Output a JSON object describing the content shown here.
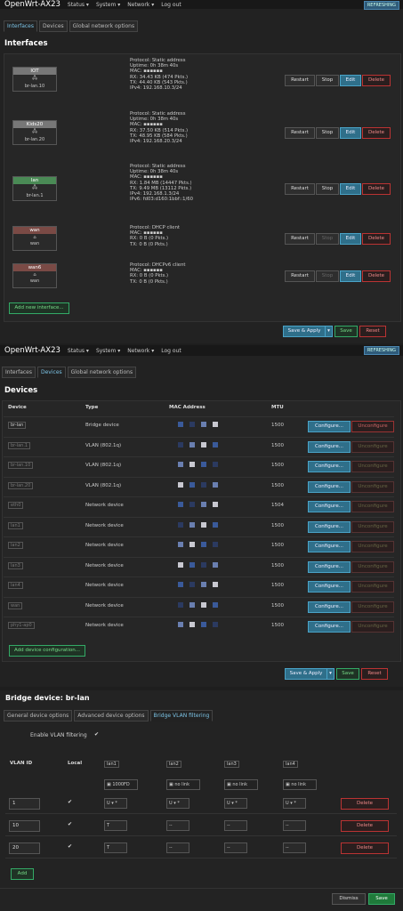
{
  "panel1": {
    "brand": "OpenWrt-AX23",
    "menu": [
      "Status ▾",
      "System ▾",
      "Network ▾",
      "Log out"
    ],
    "badge": "REFRESHING",
    "tabs": [
      "Interfaces",
      "Devices",
      "Global network options"
    ],
    "heading": "Interfaces",
    "interfaces": [
      {
        "name": "IOT",
        "device": "br-lan.10",
        "color": "#777777",
        "lines": [
          "Protocol: Static address",
          "Uptime: 0h 38m 40s",
          "MAC: ▪▪▪▪▪▪",
          "RX: 34.43 KB (474 Pkts.)",
          "TX: 44.40 KB (543 Pkts.)",
          "IPv4: 192.168.10.3/24"
        ]
      },
      {
        "name": "Kids20",
        "device": "br-lan.20",
        "color": "#777777",
        "lines": [
          "Protocol: Static address",
          "Uptime: 0h 38m 40s",
          "MAC: ▪▪▪▪▪▪",
          "RX: 37.50 KB (514 Pkts.)",
          "TX: 48.95 KB (584 Pkts.)",
          "IPv4: 192.168.20.3/24"
        ]
      },
      {
        "name": "lan",
        "device": "br-lan.1",
        "color": "#4a8a55",
        "lines": [
          "Protocol: Static address",
          "Uptime: 0h 38m 40s",
          "MAC: ▪▪▪▪▪▪",
          "RX: 1.84 MB (14447 Pkts.)",
          "TX: 9.49 MB (13112 Pkts.)",
          "IPv4: 192.168.1.3/24",
          "IPv6: fd03:d160:1bbf::1/60"
        ]
      },
      {
        "name": "wan",
        "device": "wan",
        "color": "#7a4a45",
        "lines": [
          "Protocol: DHCP client",
          "MAC: ▪▪▪▪▪▪",
          "RX: 0 B (0 Pkts.)",
          "TX: 0 B (0 Pkts.)"
        ]
      },
      {
        "name": "wan6",
        "device": "wan",
        "color": "#7a4a45",
        "lines": [
          "Protocol: DHCPv6 client",
          "MAC: ▪▪▪▪▪▪",
          "RX: 0 B (0 Pkts.)",
          "TX: 0 B (0 Pkts.)"
        ]
      }
    ],
    "buttons": {
      "restart": "Restart",
      "stop": "Stop",
      "edit": "Edit",
      "delete": "Delete"
    },
    "add_interface": "Add new interface...",
    "save_apply": "Save & Apply",
    "save": "Save",
    "reset": "Reset"
  },
  "panel2": {
    "brand": "OpenWrt-AX23",
    "menu": [
      "Status ▾",
      "System ▾",
      "Network ▾",
      "Log out"
    ],
    "badge": "REFRESHING",
    "tabs": [
      "Interfaces",
      "Devices",
      "Global network options"
    ],
    "heading": "Devices",
    "columns": [
      "Device",
      "Type",
      "MAC Address",
      "MTU"
    ],
    "devices": [
      {
        "name": "br-lan",
        "type": "Bridge device",
        "mtu": "1500",
        "unconfigure_enabled": true
      },
      {
        "name": "br-lan.1",
        "type": "VLAN (802.1q)",
        "mtu": "1500",
        "unconfigure_enabled": false
      },
      {
        "name": "br-lan.10",
        "type": "VLAN (802.1q)",
        "mtu": "1500",
        "unconfigure_enabled": false
      },
      {
        "name": "br-lan.20",
        "type": "VLAN (802.1q)",
        "mtu": "1500",
        "unconfigure_enabled": false
      },
      {
        "name": "eth0",
        "type": "Network device",
        "mtu": "1504",
        "unconfigure_enabled": false
      },
      {
        "name": "lan1",
        "type": "Network device",
        "mtu": "1500",
        "unconfigure_enabled": false
      },
      {
        "name": "lan2",
        "type": "Network device",
        "mtu": "1500",
        "unconfigure_enabled": false
      },
      {
        "name": "lan3",
        "type": "Network device",
        "mtu": "1500",
        "unconfigure_enabled": false
      },
      {
        "name": "lan4",
        "type": "Network device",
        "mtu": "1500",
        "unconfigure_enabled": false
      },
      {
        "name": "wan",
        "type": "Network device",
        "mtu": "1500",
        "unconfigure_enabled": false
      },
      {
        "name": "phy1-ap0",
        "type": "Network device",
        "mtu": "1500",
        "unconfigure_enabled": false
      }
    ],
    "configure": "Configure...",
    "unconfigure": "Unconfigure",
    "add_device": "Add device configuration...",
    "save_apply": "Save & Apply",
    "save": "Save",
    "reset": "Reset"
  },
  "panel3": {
    "title": "Bridge device: br-lan",
    "tabs": [
      "General device options",
      "Advanced device options",
      "Bridge VLAN filtering"
    ],
    "enable_label": "Enable VLAN filtering",
    "enable_checked": true,
    "col_vlan": "VLAN ID",
    "col_local": "Local",
    "ports": [
      {
        "name": "lan1",
        "status": "1000FD"
      },
      {
        "name": "lan2",
        "status": "no link"
      },
      {
        "name": "lan3",
        "status": "no link"
      },
      {
        "name": "lan4",
        "status": "no link"
      }
    ],
    "vlans": [
      {
        "id": "1",
        "local": true,
        "ports": [
          "U ▾ *",
          "U ▾ *",
          "U ▾ *",
          "U ▾ *"
        ]
      },
      {
        "id": "10",
        "local": true,
        "ports": [
          "T",
          "--",
          "--",
          "--"
        ]
      },
      {
        "id": "20",
        "local": true,
        "ports": [
          "T",
          "--",
          "--",
          "--"
        ]
      }
    ],
    "delete": "Delete",
    "add": "Add",
    "dismiss": "Dismiss",
    "save": "Save"
  }
}
